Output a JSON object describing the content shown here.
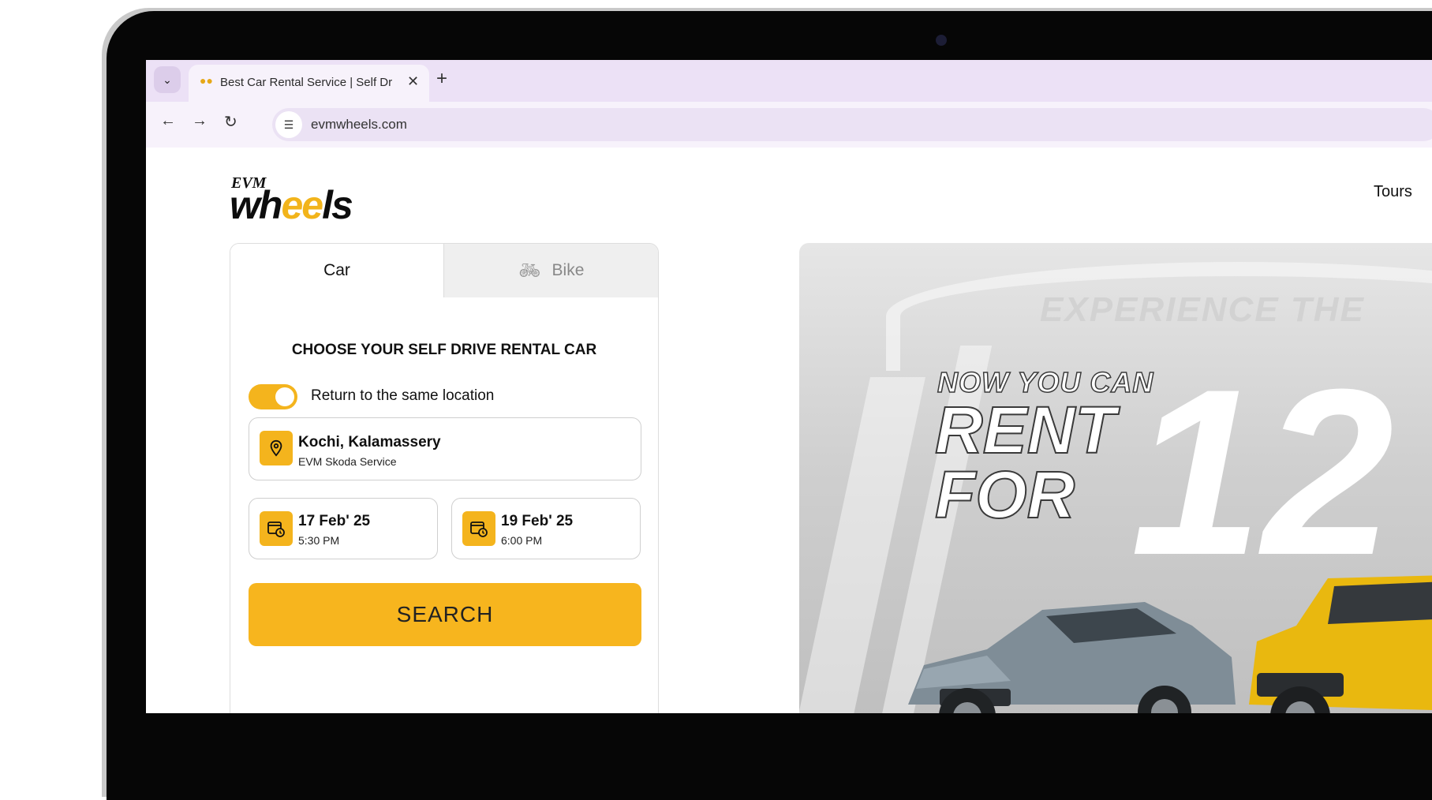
{
  "browser": {
    "tab_title": "Best Car Rental Service | Self Dr",
    "url": "evmwheels.com"
  },
  "logo": {
    "top": "EVM",
    "main_prefix": "wh",
    "main_accent": "ee",
    "main_suffix": "ls"
  },
  "nav": {
    "tours": "Tours"
  },
  "booking": {
    "tab_car": "Car",
    "tab_bike": "Bike",
    "title": "CHOOSE YOUR SELF DRIVE RENTAL CAR",
    "toggle_label": "Return to the same location",
    "toggle_on": true,
    "location": {
      "name": "Kochi, Kalamassery",
      "detail": "EVM Skoda Service"
    },
    "pickup": {
      "date": "17 Feb' 25",
      "time": "5:30 PM"
    },
    "dropoff": {
      "date": "19 Feb' 25",
      "time": "6:00 PM"
    },
    "search_label": "SEARCH"
  },
  "banner": {
    "ghost": "EXPERIENCE THE",
    "line1": "NOW YOU CAN",
    "line2": "RENT",
    "line3": "FOR",
    "big_number": "12"
  },
  "colors": {
    "accent": "#f4b41d",
    "tab_bar": "#ece1f6",
    "bezel": "#060606"
  }
}
